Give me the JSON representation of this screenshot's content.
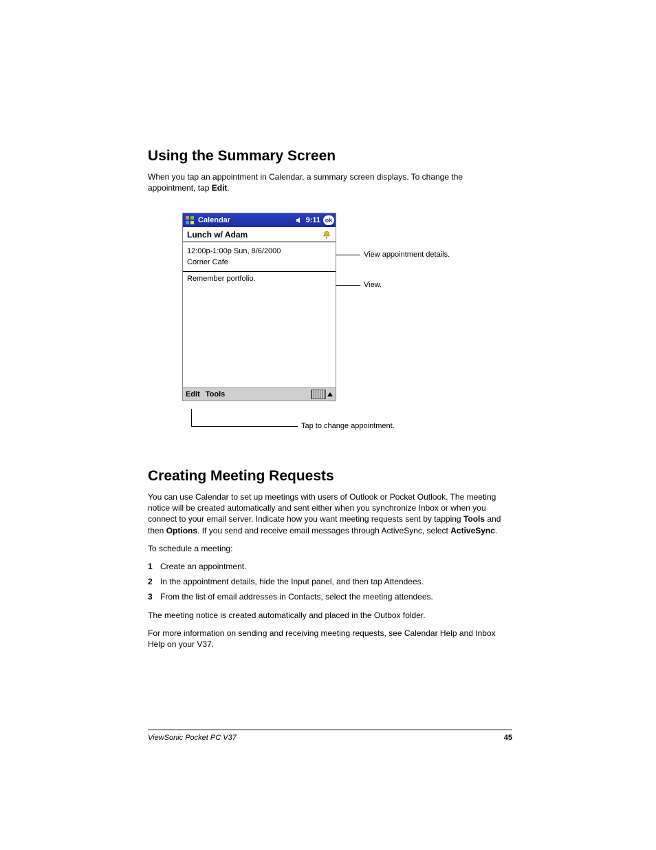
{
  "section1": {
    "heading": "Using the Summary Screen",
    "para_part1": "When you tap an appointment in Calendar, a summary screen displays. To change the appointment, tap ",
    "para_bold": "Edit",
    "para_part2": "."
  },
  "device": {
    "titlebar": {
      "app": "Calendar",
      "time": "9:11",
      "ok": "ok"
    },
    "summary_title": "Lunch w/ Adam",
    "details_line1": "12:00p-1:00p Sun, 8/6/2000",
    "details_line2": "Corner Cafe",
    "notes": "Remember portfolio.",
    "menu_edit": "Edit",
    "menu_tools": "Tools"
  },
  "callouts": {
    "view_details": "View appointment details.",
    "view": "View.",
    "tap_change": "Tap to change appointment."
  },
  "section2": {
    "heading": "Creating Meeting Requests",
    "para1_a": "You can use Calendar to set up meetings with users of Outlook or Pocket Outlook. The meeting notice will be created automatically and sent either when you synchronize Inbox or when you connect to your email server. Indicate how you want meeting requests sent by tapping ",
    "para1_b1": "Tools",
    "para1_c": " and then ",
    "para1_b2": "Options",
    "para1_d": ". If you send and receive email messages through ActiveSync, select ",
    "para1_b3": "ActiveSync",
    "para1_e": ".",
    "para2": "To schedule a meeting:",
    "steps": [
      {
        "n": "1",
        "t_a": "Create an appointment.",
        "t_b": "",
        "t_c": ""
      },
      {
        "n": "2",
        "t_a": "In the appointment details, hide the Input panel, and then tap ",
        "t_b": "Attendees",
        "t_c": "."
      },
      {
        "n": "3",
        "t_a": "From the list of email addresses in Contacts, select the meeting attendees.",
        "t_b": "",
        "t_c": ""
      }
    ],
    "para3": "The meeting notice is created automatically and placed in the Outbox folder.",
    "para4": "For more information on sending and receiving meeting requests, see Calendar Help and Inbox Help on your V37."
  },
  "footer": {
    "product": "ViewSonic  Pocket PC  V37",
    "page": "45"
  }
}
